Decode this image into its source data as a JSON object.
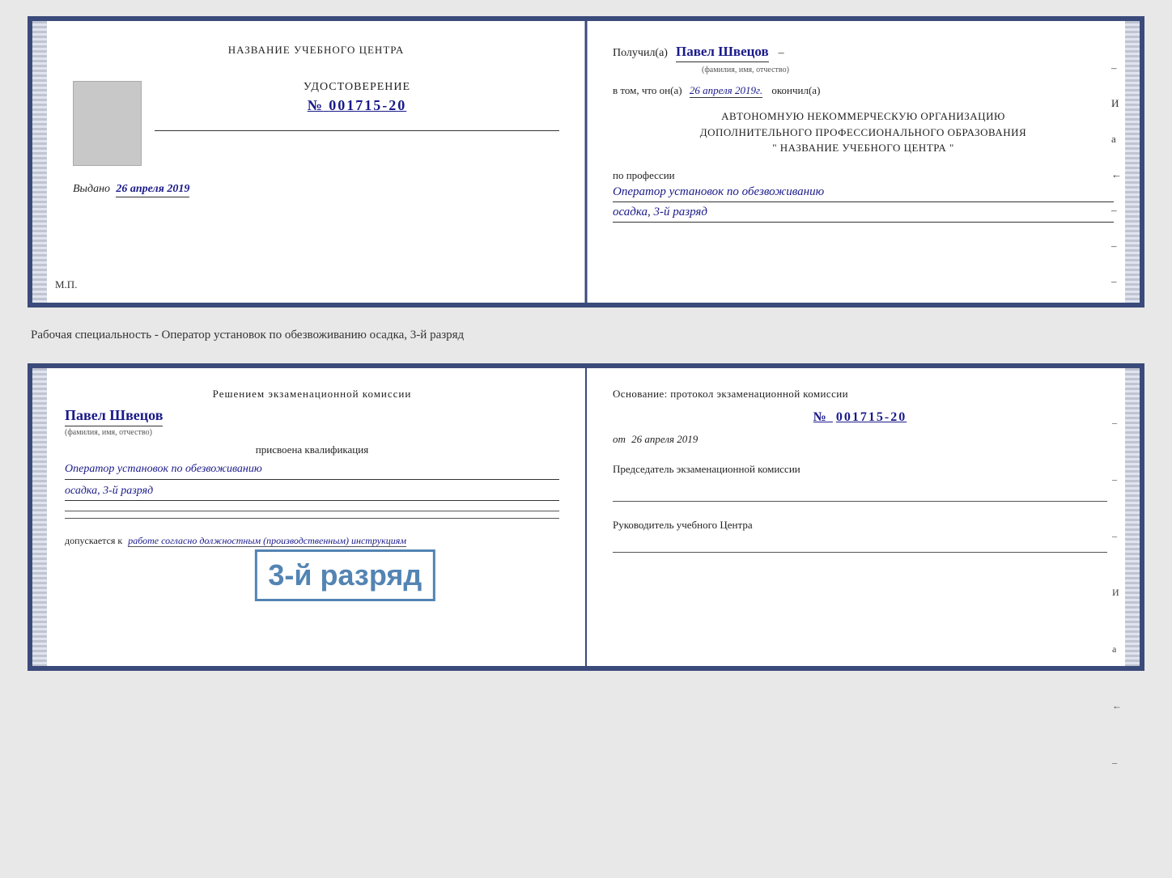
{
  "page": {
    "background_color": "#e8e8e8"
  },
  "top_card": {
    "left": {
      "title": "НАЗВАНИЕ УЧЕБНОГО ЦЕНТРА",
      "cert_label": "УДОСТОВЕРЕНИЕ",
      "cert_number_prefix": "№",
      "cert_number": "001715-20",
      "issued_label": "Выдано",
      "issued_date": "26 апреля 2019",
      "mp_label": "М.П."
    },
    "right": {
      "received_prefix": "Получил(а)",
      "recipient_name": "Павел Швецов",
      "fio_label": "(фамилия, имя, отчество)",
      "dash": "–",
      "in_that_prefix": "в том, что он(а)",
      "date_field": "26 апреля 2019г.",
      "finished_label": "окончил(а)",
      "org_line1": "АВТОНОМНУЮ НЕКОММЕРЧЕСКУЮ ОРГАНИЗАЦИЮ",
      "org_line2": "ДОПОЛНИТЕЛЬНОГО ПРОФЕССИОНАЛЬНОГО ОБРАЗОВАНИЯ",
      "org_line3": "\"  НАЗВАНИЕ УЧЕБНОГО ЦЕНТРА  \"",
      "profession_label": "по профессии",
      "profession_line1": "Оператор установок по обезвоживанию",
      "profession_line2": "осадка, 3-й разряд"
    }
  },
  "separator": {
    "text": "Рабочая специальность - Оператор установок по обезвоживанию осадка, 3-й разряд"
  },
  "bottom_card": {
    "left": {
      "decision_text": "Решением экзаменационной комиссии",
      "name": "Павел Швецов",
      "fio_label": "(фамилия, имя, отчество)",
      "qualification_text": "присвоена квалификация",
      "profession_line1": "Оператор установок по обезвоживанию",
      "profession_line2": "осадка, 3-й разряд",
      "dopusk_prefix": "допускается к",
      "dopusk_text": "работе согласно должностным (производственным) инструкциям"
    },
    "stamp": {
      "text": "3-й разряд"
    },
    "right": {
      "osnov_text": "Основание: протокол экзаменационной комиссии",
      "protocol_number_prefix": "№",
      "protocol_number": "001715-20",
      "from_label": "от",
      "from_date": "26 апреля 2019",
      "chairman_label": "Председатель экзаменационной комиссии",
      "head_label": "Руководитель учебного Центра"
    },
    "right_edge_marks": {
      "marks": [
        "И",
        "а",
        "←",
        "–",
        "–",
        "–",
        "–"
      ]
    }
  }
}
